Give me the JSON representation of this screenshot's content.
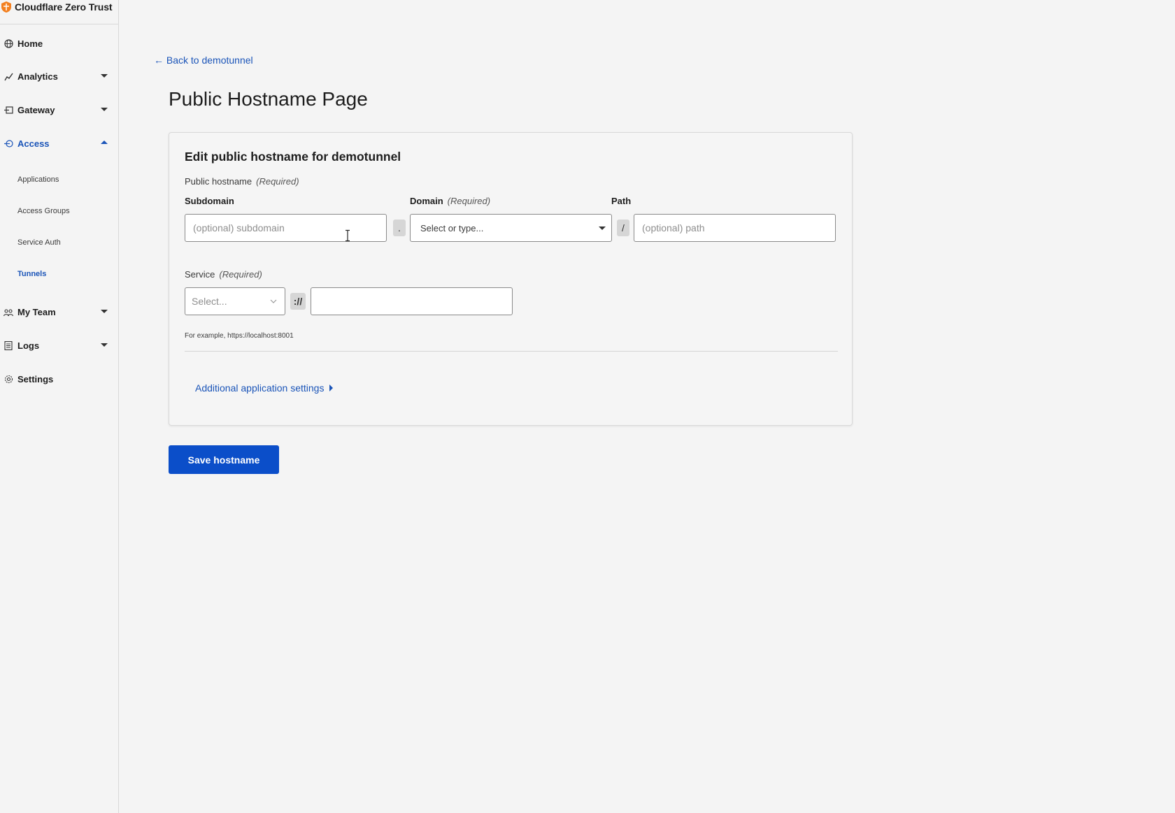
{
  "app": {
    "title": "Cloudflare Zero Trust"
  },
  "sidebar": {
    "items": [
      {
        "label": "Home",
        "icon": "globe-icon"
      },
      {
        "label": "Analytics",
        "icon": "analytics-icon"
      },
      {
        "label": "Gateway",
        "icon": "gateway-icon"
      },
      {
        "label": "Access",
        "icon": "access-icon"
      },
      {
        "label": "My Team",
        "icon": "team-icon"
      },
      {
        "label": "Logs",
        "icon": "logs-icon"
      },
      {
        "label": "Settings",
        "icon": "gear-icon"
      }
    ],
    "access_subitems": [
      {
        "label": "Applications"
      },
      {
        "label": "Access Groups"
      },
      {
        "label": "Service Auth"
      },
      {
        "label": "Tunnels"
      }
    ],
    "active_section": "Access",
    "active_subitem": "Tunnels"
  },
  "main": {
    "back_link": "← Back to demotunnel",
    "page_title": "Public Hostname Page",
    "card": {
      "title": "Edit public hostname for demotunnel",
      "public_hostname_label": "Public hostname",
      "required": "(Required)",
      "subdomain_label": "Subdomain",
      "subdomain_placeholder": "(optional) subdomain",
      "dot_separator": ".",
      "domain_label": "Domain",
      "domain_placeholder": "Select or type...",
      "slash_separator": "/",
      "path_label": "Path",
      "path_placeholder": "(optional) path",
      "service_label": "Service",
      "service_type_placeholder": "Select...",
      "scheme_separator": "://",
      "service_url_value": "",
      "example_hint": "For example, https://localhost:8001",
      "additional_settings": "Additional application settings"
    },
    "save_button": "Save hostname"
  },
  "colors": {
    "accent": "#1a54b8",
    "primary_button": "#0b4ec9",
    "brand_orange": "#f38020"
  }
}
